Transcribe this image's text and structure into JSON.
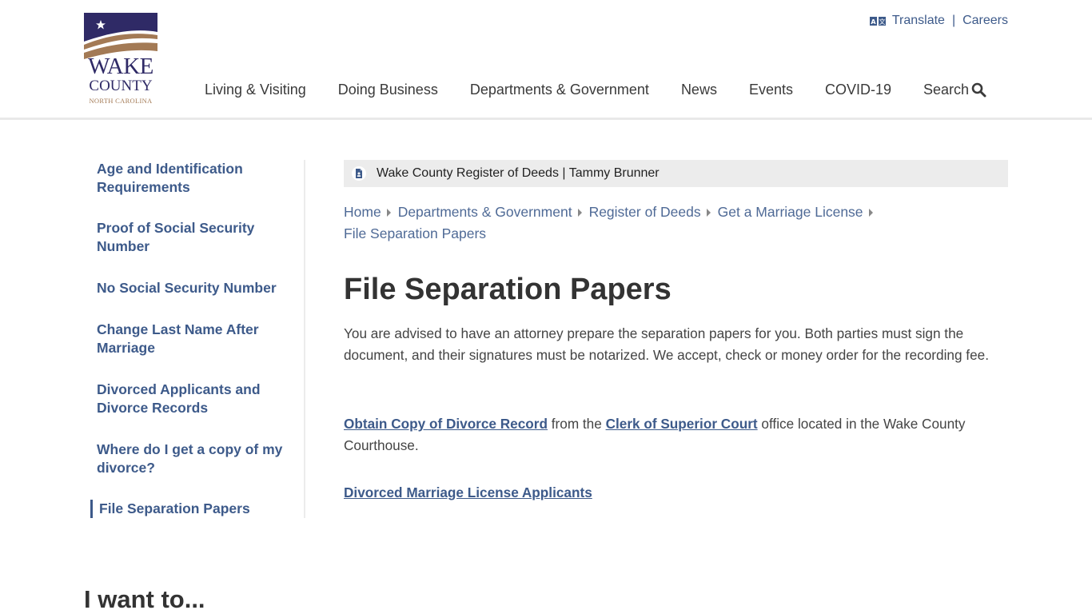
{
  "logo": {
    "line1": "WAKE",
    "line2": "COUNTY",
    "line3": "NORTH CAROLINA",
    "colors": {
      "navy": "#2f2a66",
      "tan": "#a37a55"
    }
  },
  "utility": {
    "translate_icon": "translate-icon",
    "translate_label": "Translate",
    "separator": "|",
    "careers_label": "Careers"
  },
  "nav": {
    "items": [
      {
        "label": "Living & Visiting"
      },
      {
        "label": "Doing Business"
      },
      {
        "label": "Departments & Government"
      },
      {
        "label": "News"
      },
      {
        "label": "Events"
      },
      {
        "label": "COVID-19"
      }
    ],
    "search_label": "Search",
    "search_icon": "search-icon"
  },
  "sidebar": {
    "items": [
      {
        "label": "Age and Identification Requirements",
        "active": false
      },
      {
        "label": "Proof of Social Security Number",
        "active": false
      },
      {
        "label": "No Social Security Number",
        "active": false
      },
      {
        "label": "Change Last Name After Marriage",
        "active": false
      },
      {
        "label": "Divorced Applicants and Divorce Records",
        "active": false
      },
      {
        "label": "Where do I get a copy of my divorce?",
        "active": false
      },
      {
        "label": "File Separation Papers",
        "active": true
      }
    ]
  },
  "agency_bar": {
    "icon": "document-user-icon",
    "text": "Wake County Register of Deeds | Tammy Brunner"
  },
  "breadcrumb": {
    "items": [
      {
        "label": "Home"
      },
      {
        "label": "Departments & Government"
      },
      {
        "label": "Register of Deeds"
      },
      {
        "label": "Get a Marriage License"
      },
      {
        "label": "File Separation Papers"
      }
    ]
  },
  "page": {
    "title": "File Separation Papers",
    "paragraph1": "You are advised to have an attorney prepare the separation papers for you. Both parties must sign the document, and their signatures must be notarized. We accept, check or money order for the recording fee.",
    "paragraph2": {
      "link1": "Obtain Copy of Divorce Record",
      "text1": " from the ",
      "link2": "Clerk of Superior Court",
      "text2": " office located in the Wake County Courthouse."
    },
    "paragraph3_link": "Divorced Marriage License Applicants"
  },
  "footer_heading": "I want to...",
  "colors": {
    "link": "#3d5a8a",
    "heading": "#333333",
    "agency_bar_bg": "#ececec"
  }
}
